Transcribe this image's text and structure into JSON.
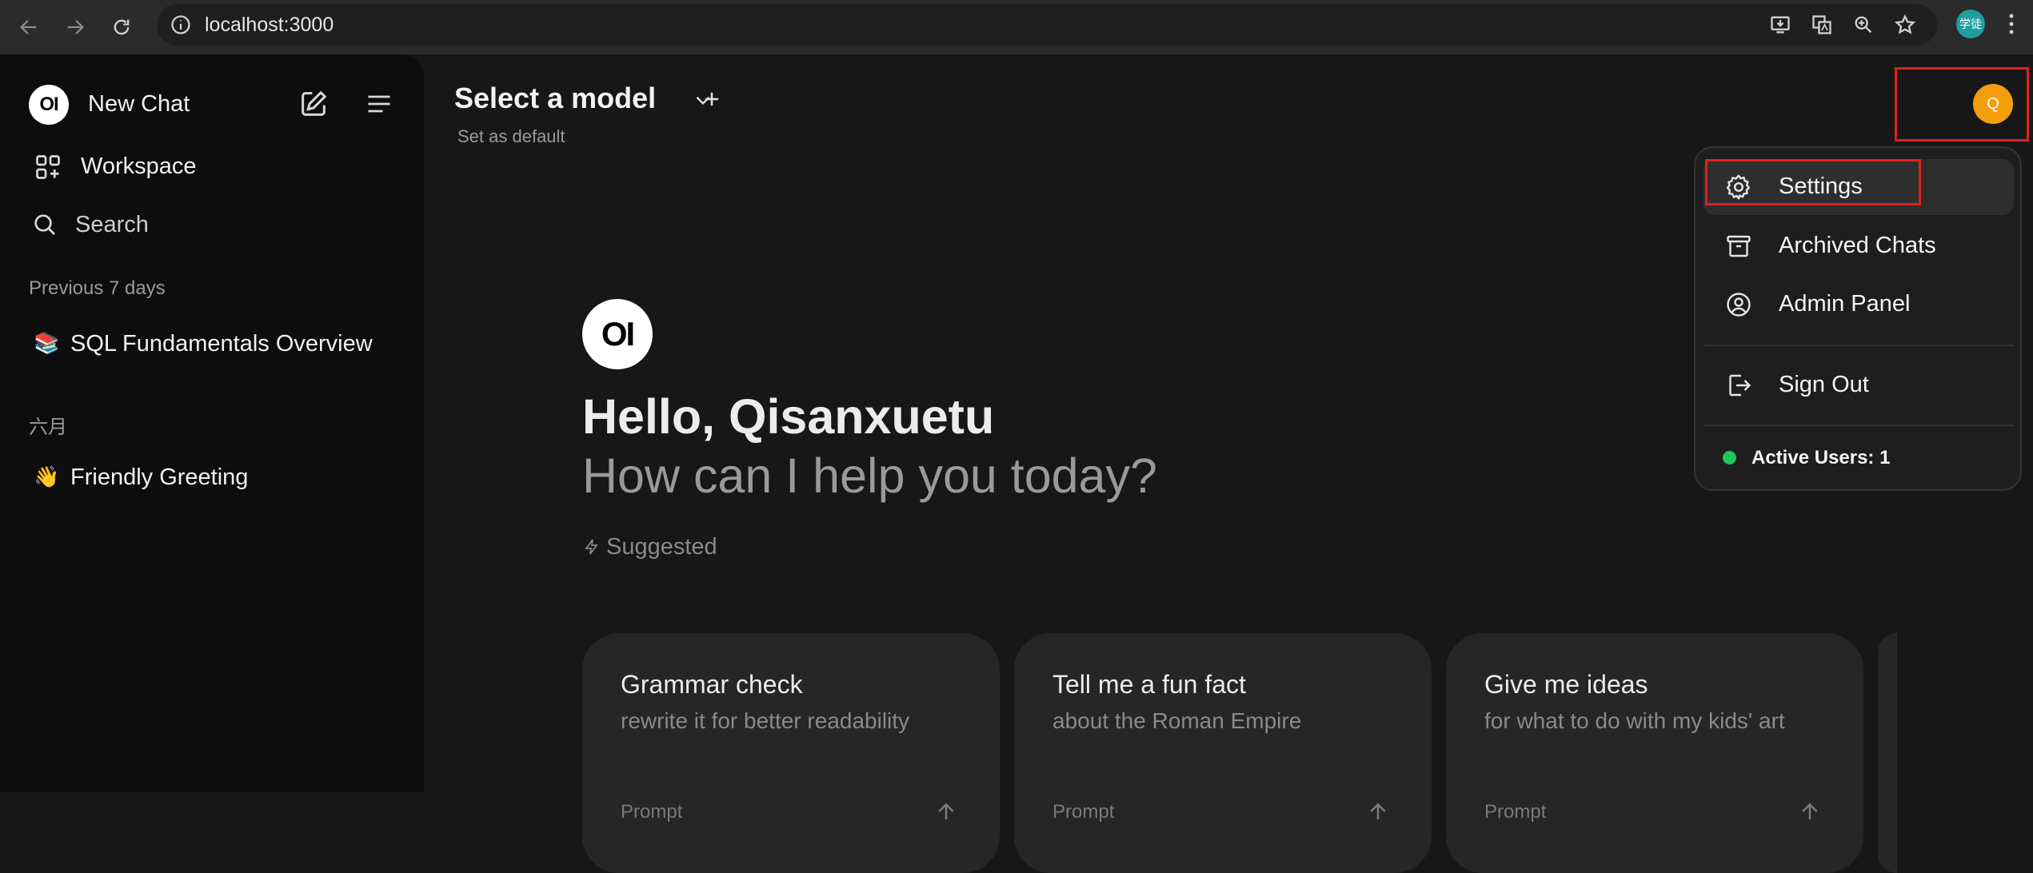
{
  "browser": {
    "url": "localhost:3000",
    "profile_label": "学徒"
  },
  "sidebar": {
    "logo_text": "OI",
    "new_chat_label": "New Chat",
    "workspace_label": "Workspace",
    "search_label": "Search",
    "sections": [
      {
        "heading": "Previous 7 days",
        "chats": [
          {
            "emoji": "📚",
            "title": "SQL Fundamentals Overview"
          }
        ]
      },
      {
        "heading": "六月",
        "chats": [
          {
            "emoji": "👋",
            "title": "Friendly Greeting"
          }
        ]
      }
    ]
  },
  "header": {
    "model_selector": "Select a model",
    "set_default": "Set as default",
    "avatar_initial": "Q",
    "avatar_color": "#f59e0b"
  },
  "hero": {
    "logo_text": "OI",
    "greeting": "Hello, Qisanxuetu",
    "subtitle": "How can I help you today?",
    "suggested_label": "Suggested"
  },
  "suggestions": [
    {
      "title": "Grammar check",
      "subtitle": "rewrite it for better readability",
      "prompt_label": "Prompt"
    },
    {
      "title": "Tell me a fun fact",
      "subtitle": "about the Roman Empire",
      "prompt_label": "Prompt"
    },
    {
      "title": "Give me ideas",
      "subtitle": "for what to do with my kids' art",
      "prompt_label": "Prompt"
    }
  ],
  "user_menu": {
    "items": [
      {
        "label": "Settings",
        "icon": "gear-icon"
      },
      {
        "label": "Archived Chats",
        "icon": "archive-icon"
      },
      {
        "label": "Admin Panel",
        "icon": "user-circle-icon"
      }
    ],
    "sign_out_label": "Sign Out",
    "active_users_label": "Active Users: 1",
    "active_color": "#22c55e"
  },
  "colors": {
    "highlight_box": "#e02020"
  }
}
